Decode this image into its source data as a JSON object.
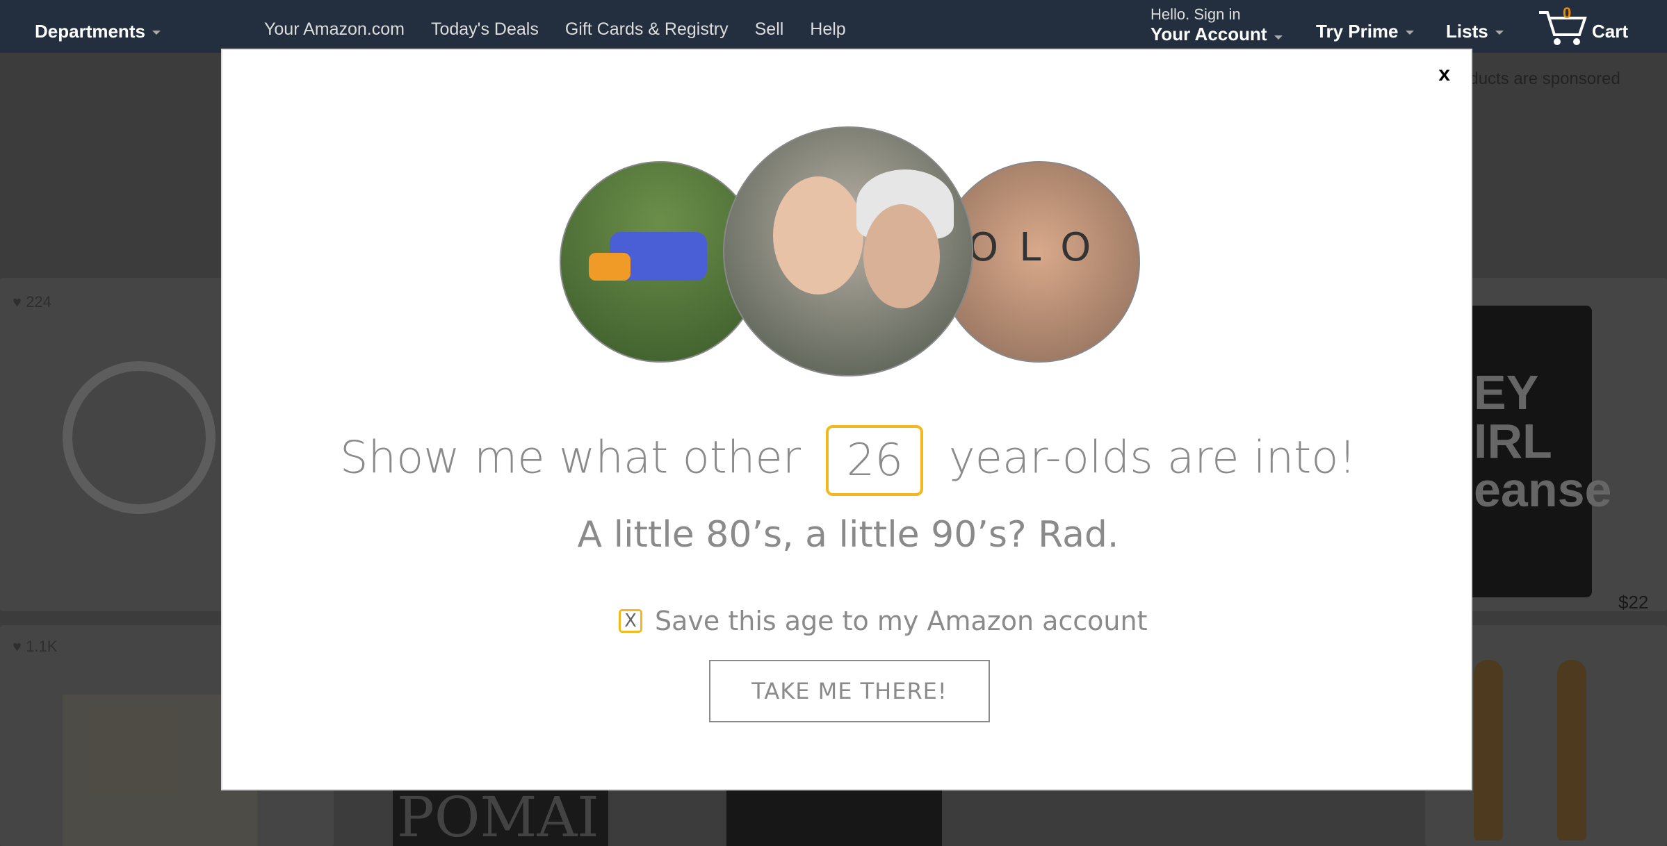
{
  "nav": {
    "departments": "Departments",
    "links": [
      "Your Amazon.com",
      "Today's Deals",
      "Gift Cards & Registry",
      "Sell",
      "Help"
    ],
    "account_greeting": "Hello. Sign in",
    "account_label": "Your Account",
    "prime_label": "Try Prime",
    "lists_label": "Lists",
    "cart_count": "0",
    "cart_label": "Cart"
  },
  "background": {
    "sponsored_text": "oducts are sponsored",
    "likes": [
      "224",
      "1.1K"
    ],
    "price": "$22",
    "bag_text": "EY\nIRL\neanse",
    "pomade_text": "POMAI"
  },
  "modal": {
    "close_label": "x",
    "headline_before": "Show me what other",
    "age_value": "26",
    "headline_after": "year-olds are into!",
    "subheadline": "A little 80’s, a little 90’s? Rad.",
    "checkbox_mark": "X",
    "save_label": "Save this age to my Amazon account",
    "cta_label": "TAKE ME THERE!",
    "knuckles_text": "OLO"
  },
  "colors": {
    "nav_bg": "#232f3e",
    "accent_yellow": "#f3b81c",
    "cart_count": "#f08804",
    "modal_text": "#8a8a8a"
  }
}
